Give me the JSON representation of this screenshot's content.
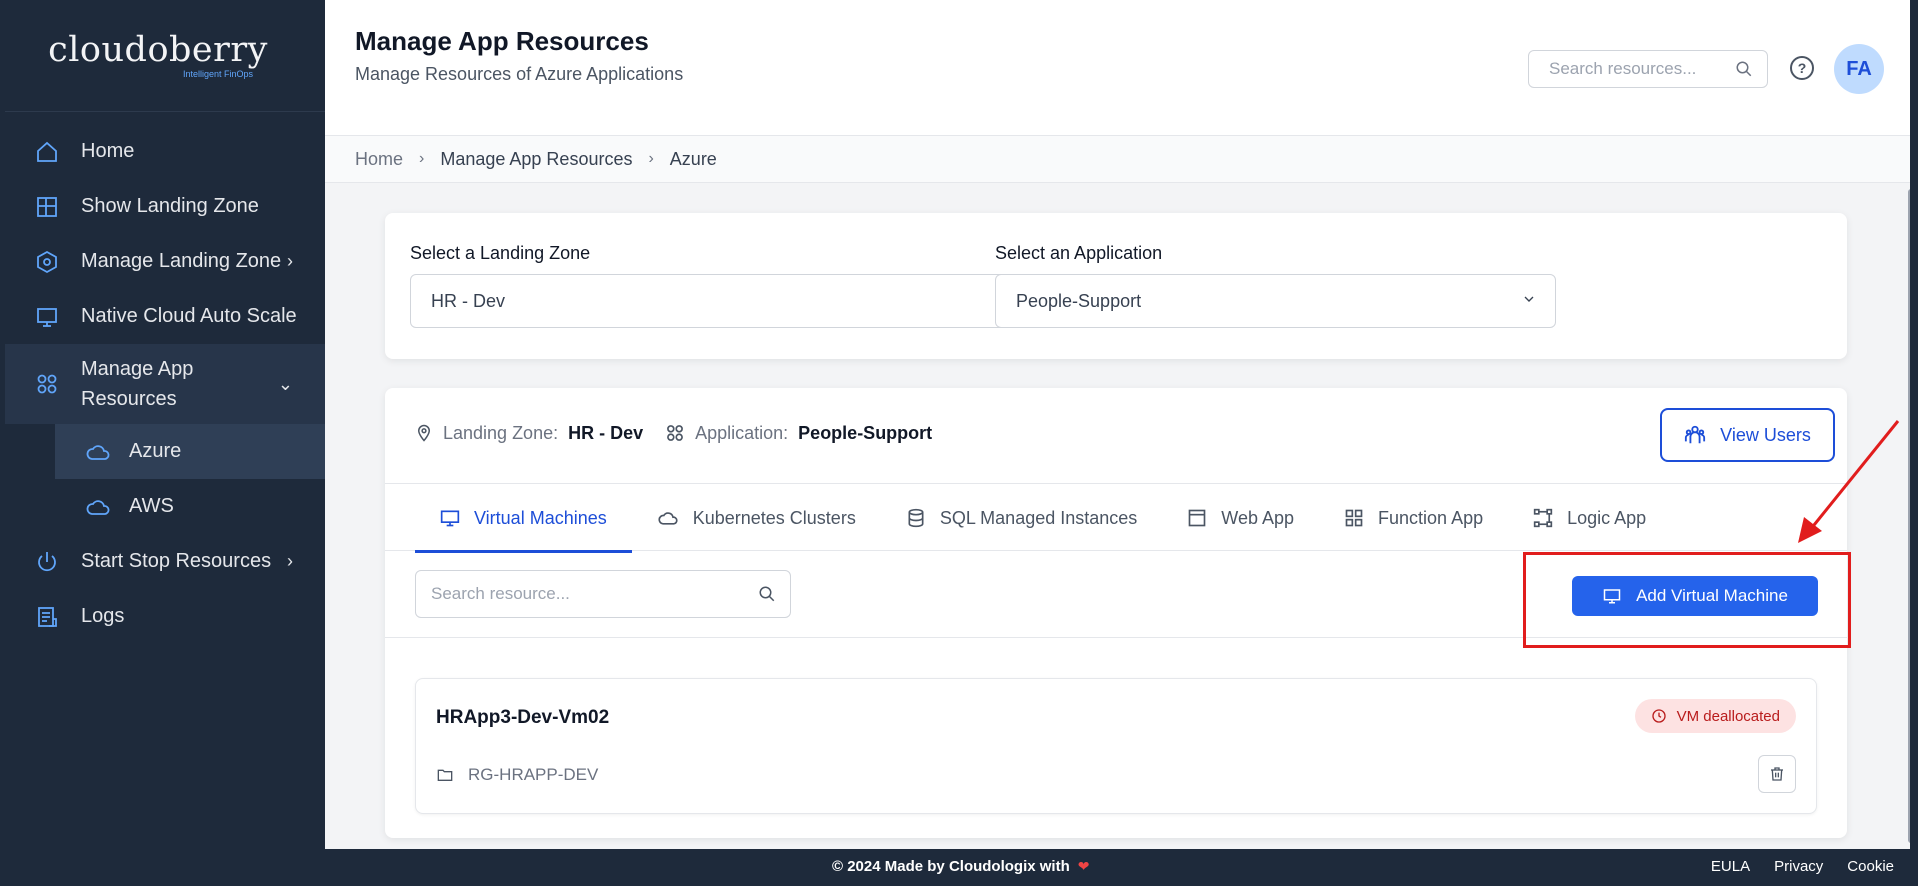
{
  "logo": {
    "word": "cloudoberry",
    "tagline": "Intelligent FinOps"
  },
  "sidebar": {
    "items": [
      {
        "label": "Home",
        "icon": "home-icon"
      },
      {
        "label": "Show Landing Zone",
        "icon": "grid-icon"
      },
      {
        "label": "Manage Landing Zone",
        "icon": "hexagon-icon",
        "chevron": "›"
      },
      {
        "label": "Native Cloud Auto Scale",
        "icon": "monitor-icon"
      },
      {
        "label": "Manage App Resources",
        "icon": "apps-icon",
        "chevron": "⌄"
      },
      {
        "label": "Start Stop Resources",
        "icon": "power-icon",
        "chevron": "›"
      },
      {
        "label": "Logs",
        "icon": "logs-icon"
      }
    ],
    "sub_items": [
      {
        "label": "Azure",
        "icon": "cloud-icon",
        "active": true
      },
      {
        "label": "AWS",
        "icon": "cloud-icon",
        "active": false
      }
    ]
  },
  "header": {
    "title": "Manage App Resources",
    "subtitle": "Manage Resources of Azure Applications",
    "search_placeholder": "Search resources...",
    "help": "?",
    "avatar": "FA"
  },
  "breadcrumb": {
    "home": "Home",
    "mid": "Manage App Resources",
    "last": "Azure",
    "sep": "›"
  },
  "selectors": {
    "landing_zone_label": "Select a Landing Zone",
    "landing_zone_value": "HR - Dev",
    "application_label": "Select an Application",
    "application_value": "People-Support"
  },
  "info": {
    "landing_zone_label": "Landing Zone:",
    "landing_zone_value": "HR - Dev",
    "application_label": "Application:",
    "application_value": "People-Support",
    "view_users": "View Users"
  },
  "tabs": [
    {
      "label": "Virtual Machines",
      "active": true
    },
    {
      "label": "Kubernetes Clusters",
      "active": false
    },
    {
      "label": "SQL Managed Instances",
      "active": false
    },
    {
      "label": "Web App",
      "active": false
    },
    {
      "label": "Function App",
      "active": false
    },
    {
      "label": "Logic App",
      "active": false
    }
  ],
  "toolbar": {
    "search_placeholder": "Search resource...",
    "add_button": "Add Virtual Machine"
  },
  "vm": {
    "name": "HRApp3-Dev-Vm02",
    "status": "VM deallocated",
    "resource_group": "RG-HRAPP-DEV"
  },
  "footer": {
    "copyright": "© 2024 Made by Cloudologix with",
    "heart": "❤",
    "links": [
      "EULA",
      "Privacy",
      "Cookie"
    ]
  },
  "colors": {
    "sidebar_bg": "#1e2a3b",
    "accent": "#2563eb",
    "highlight": "#e11d1d",
    "status_bg": "#fde2e2",
    "status_text": "#b91c1c"
  }
}
